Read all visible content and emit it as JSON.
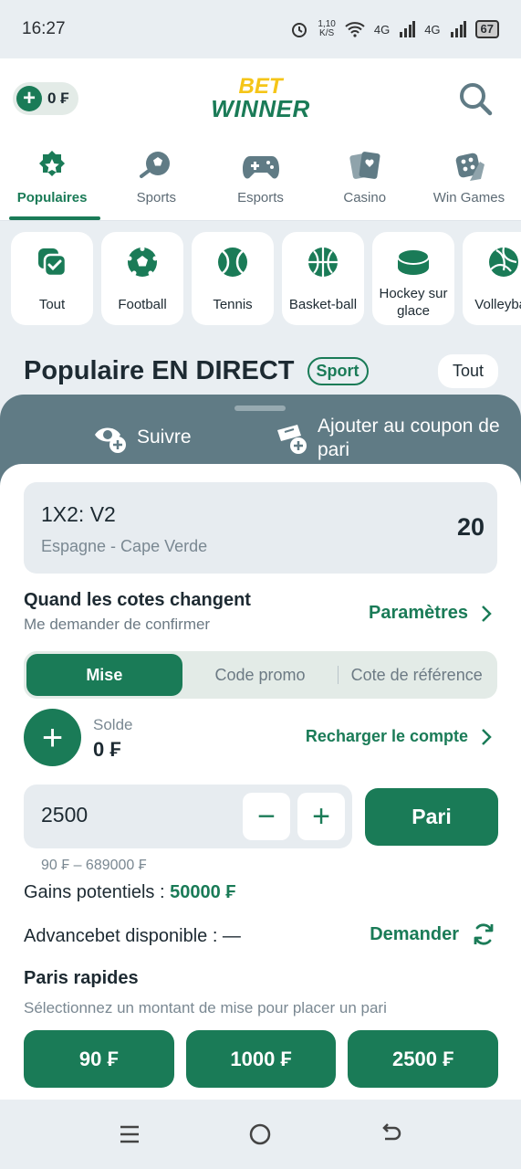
{
  "status_bar": {
    "time": "16:27",
    "network_speed": "1,10\nK/S",
    "signal_1": "4G",
    "signal_2": "4G",
    "battery": "67"
  },
  "header": {
    "balance": "0 ₣",
    "logo_top": "BET",
    "logo_bottom": "WINNER"
  },
  "top_tabs": [
    {
      "label": "Populaires",
      "icon": "star-badge-icon",
      "active": true
    },
    {
      "label": "Sports",
      "icon": "soccer-ball-icon"
    },
    {
      "label": "Esports",
      "icon": "gamepad-icon"
    },
    {
      "label": "Casino",
      "icon": "cards-icon"
    },
    {
      "label": "Win Games",
      "icon": "dice-icon"
    }
  ],
  "sport_chips": [
    {
      "label": "Tout",
      "icon": "check-stack-icon"
    },
    {
      "label": "Football",
      "icon": "football-icon"
    },
    {
      "label": "Tennis",
      "icon": "tennis-ball-icon"
    },
    {
      "label": "Basket-ball",
      "icon": "basketball-icon"
    },
    {
      "label": "Hockey sur glace",
      "icon": "hockey-puck-icon"
    },
    {
      "label": "Volleyball",
      "icon": "volleyball-icon"
    }
  ],
  "section": {
    "title": "Populaire EN DIRECT",
    "badge": "Sport",
    "all_button": "Tout"
  },
  "sheet": {
    "follow_label": "Suivre",
    "add_coupon_label": "Ajouter au coupon de pari",
    "bet": {
      "market": "1X2: V2",
      "event": "Espagne - Cape Verde",
      "odd": "20"
    },
    "odds_change": {
      "title": "Quand les cotes changent",
      "subtitle": "Me demander de confirmer",
      "link": "Paramètres"
    },
    "segments": [
      {
        "label": "Mise",
        "active": true
      },
      {
        "label": "Code promo"
      },
      {
        "label": "Cote de référence"
      }
    ],
    "solde": {
      "label": "Solde",
      "value": "0 ₣",
      "recharge": "Recharger le compte"
    },
    "stake": {
      "value": "2500",
      "minus": "−",
      "plus": "+",
      "submit": "Pari",
      "range": "90 ₣ – 689000 ₣"
    },
    "gains": {
      "label": "Gains potentiels : ",
      "value": "50000 ₣"
    },
    "advance": {
      "label": "Advancebet disponible : —",
      "link": "Demander"
    },
    "rapid": {
      "title": "Paris rapides",
      "subtitle": "Sélectionnez un montant de mise pour placer un pari",
      "amounts": [
        "90 ₣",
        "1000 ₣",
        "2500 ₣"
      ]
    }
  },
  "colors": {
    "accent": "#1a7b57",
    "sheet_header": "#607b85",
    "background": "#e9eef2",
    "logo_yellow": "#f5c518"
  }
}
